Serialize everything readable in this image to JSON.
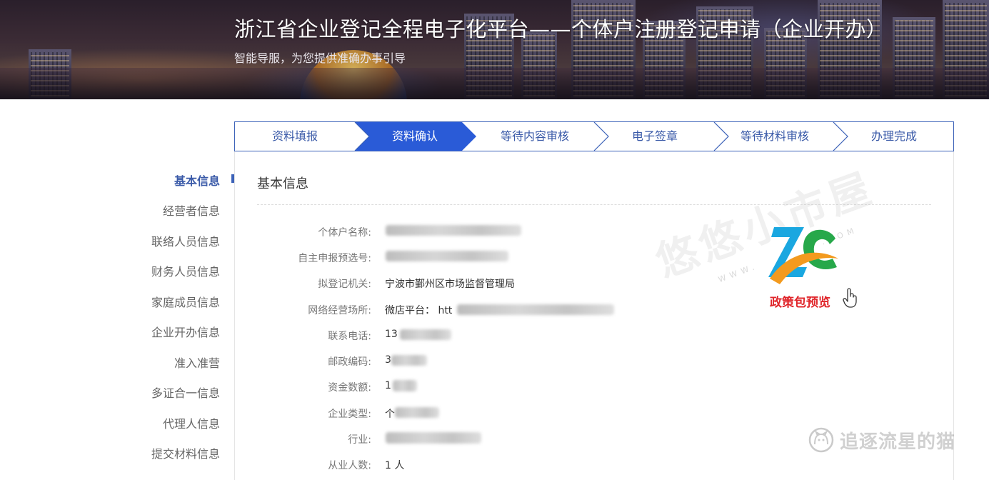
{
  "banner": {
    "title": "浙江省企业登记全程电子化平台——个体户注册登记申请（企业开办）",
    "subtitle": "智能导服，为您提供准确办事引导"
  },
  "steps": [
    {
      "label": "资料填报",
      "active": false
    },
    {
      "label": "资料确认",
      "active": true
    },
    {
      "label": "等待内容审核",
      "active": false
    },
    {
      "label": "电子签章",
      "active": false
    },
    {
      "label": "等待材料审核",
      "active": false
    },
    {
      "label": "办理完成",
      "active": false
    }
  ],
  "sidebar": {
    "items": [
      {
        "label": "基本信息",
        "active": true
      },
      {
        "label": "经营者信息"
      },
      {
        "label": "联络人员信息"
      },
      {
        "label": "财务人员信息"
      },
      {
        "label": "家庭成员信息"
      },
      {
        "label": "企业开办信息"
      },
      {
        "label": "准入准营"
      },
      {
        "label": "多证合一信息"
      },
      {
        "label": "代理人信息"
      },
      {
        "label": "提交材料信息"
      }
    ]
  },
  "section": {
    "title": "基本信息",
    "fields": [
      {
        "label": "个体户名称:",
        "value": ""
      },
      {
        "label": "自主申报预选号:",
        "value": ""
      },
      {
        "label": "拟登记机关:",
        "value": "宁波市鄞州区市场监督管理局"
      },
      {
        "label": "网络经营场所:",
        "value": "微店平台：  htt"
      },
      {
        "label": "联系电话:",
        "value": "13"
      },
      {
        "label": "邮政编码:",
        "value": "3"
      },
      {
        "label": "资金数额:",
        "value": "1"
      },
      {
        "label": "企业类型:",
        "value": "个"
      },
      {
        "label": "行业:",
        "value": ""
      },
      {
        "label": "从业人数:",
        "value": "1 人"
      }
    ]
  },
  "watermark": {
    "text": "悠悠小市屋",
    "www": "WWW.",
    "com": ".COM",
    "logo_caption": "政策包预览",
    "footer_text": "追逐流星的猫"
  },
  "colors": {
    "accent": "#3c62b8",
    "active_step": "#2a5bd7",
    "caption_red": "#e0262b"
  }
}
